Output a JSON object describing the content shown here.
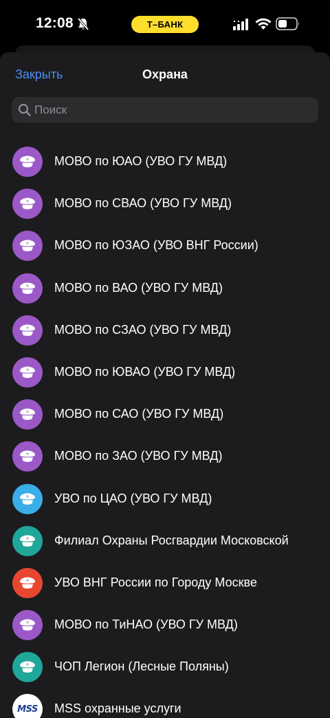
{
  "status_bar": {
    "time": "12:08",
    "bank_pill": "T–БАНК",
    "pill_color": "#ffdd2d"
  },
  "header": {
    "close_label": "Закрыть",
    "title": "Охрана",
    "accent_color": "#4a8df8"
  },
  "search": {
    "placeholder": "Поиск",
    "value": ""
  },
  "items": [
    {
      "label": "МОВО по ЮАО (УВО ГУ МВД)",
      "icon": "police-cap-icon",
      "color": "#9b59c8"
    },
    {
      "label": "МОВО по СВАО (УВО ГУ МВД)",
      "icon": "police-cap-icon",
      "color": "#9b59c8"
    },
    {
      "label": "МОВО по ЮЗАО (УВО ВНГ России)",
      "icon": "police-cap-icon",
      "color": "#9b59c8"
    },
    {
      "label": "МОВО по ВАО (УВО ГУ МВД)",
      "icon": "police-cap-icon",
      "color": "#9b59c8"
    },
    {
      "label": "МОВО по СЗАО (УВО ГУ МВД)",
      "icon": "police-cap-icon",
      "color": "#9b59c8"
    },
    {
      "label": "МОВО по ЮВАО (УВО ГУ МВД)",
      "icon": "police-cap-icon",
      "color": "#9b59c8"
    },
    {
      "label": "МОВО по САО (УВО ГУ МВД)",
      "icon": "police-cap-icon",
      "color": "#9b59c8"
    },
    {
      "label": "МОВО по ЗАО (УВО ГУ МВД)",
      "icon": "police-cap-icon",
      "color": "#9b59c8"
    },
    {
      "label": "УВО по ЦАО (УВО ГУ МВД)",
      "icon": "police-cap-icon",
      "color": "#3aaee8"
    },
    {
      "label": "Филиал Охраны Росгвардии Московской",
      "icon": "police-cap-icon",
      "color": "#1fa79a"
    },
    {
      "label": "УВО ВНГ России по Городу Москве",
      "icon": "police-cap-icon",
      "color": "#e8472f"
    },
    {
      "label": "МОВО по ТиНАО (УВО ГУ МВД)",
      "icon": "police-cap-icon",
      "color": "#9b59c8"
    },
    {
      "label": "ЧОП Легион (Лесные Поляны)",
      "icon": "police-cap-icon",
      "color": "#1fa79a"
    },
    {
      "label": "MSS охранные услуги",
      "icon": "mss-logo-icon",
      "color": "#ffffff",
      "logo_text": "MSS"
    }
  ]
}
